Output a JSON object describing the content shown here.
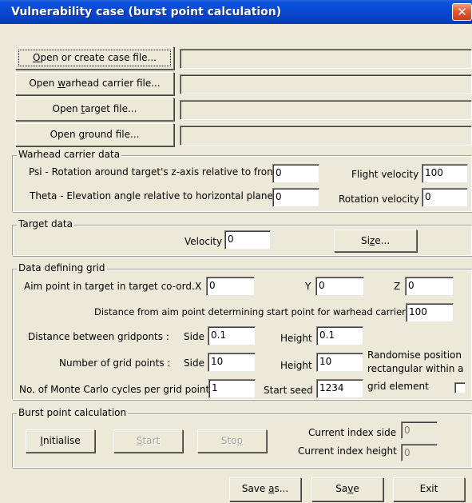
{
  "window": {
    "title": "Vulnerability case (burst point calculation)",
    "close_glyph": "✕"
  },
  "files": {
    "case_btn_pre": "",
    "case_btn_key": "O",
    "case_btn_post": "pen or create case file...",
    "warhead_btn_pre": "Open ",
    "warhead_btn_key": "w",
    "warhead_btn_post": "arhead carrier file...",
    "target_btn_pre": "Open ",
    "target_btn_key": "t",
    "target_btn_post": "arget file...",
    "ground_btn_pre": "Open ",
    "ground_btn_key": "g",
    "ground_btn_post": "round file...",
    "case_path": "",
    "warhead_path": "",
    "target_path": "",
    "ground_path": ""
  },
  "warhead": {
    "legend": "Warhead carrier data",
    "psi_label": "Psi - Rotation around target's z-axis relative to front",
    "psi_value": "0",
    "theta_label": "Theta - Elevation angle relative to horizontal plane",
    "theta_value": "0",
    "flight_velocity_label": "Flight velocity",
    "flight_velocity_value": "100",
    "rotation_velocity_label": "Rotation velocity",
    "rotation_velocity_value": "0"
  },
  "target": {
    "legend": "Target data",
    "velocity_label": "Velocity",
    "velocity_value": "0",
    "size_btn_pre": "Si",
    "size_btn_key": "z",
    "size_btn_post": "e..."
  },
  "grid": {
    "legend": "Data defining grid",
    "aim_label": "Aim point in target in target co-ord.",
    "x_label": "X",
    "x_value": "0",
    "y_label": "Y",
    "y_value": "0",
    "z_label": "Z",
    "z_value": "0",
    "distance_start_label": "Distance from aim point determining start point for warhead carrier",
    "distance_start_value": "100",
    "between_label": "Distance between gridponts :",
    "between_side_label": "Side",
    "between_side_value": "0.1",
    "between_height_label": "Height",
    "between_height_value": "0.1",
    "number_label": "Number of grid points :",
    "number_side_label": "Side",
    "number_side_value": "10",
    "number_height_label": "Height",
    "number_height_value": "10",
    "randomise_label_1": "Randomise position",
    "randomise_label_2": "rectangular within a",
    "randomise_label_3": "grid element",
    "randomise_checked": false,
    "montecarlo_label": "No. of Monte Carlo cycles per grid point",
    "montecarlo_value": "1",
    "seed_label": "Start seed",
    "seed_value": "1234"
  },
  "burst": {
    "legend": "Burst point calculation",
    "init_key": "I",
    "init_post": "nitialise",
    "start_pre": "",
    "start_key": "S",
    "start_post": "tart",
    "stop_pre": "Sto",
    "stop_key": "p",
    "stop_post": "",
    "index_side_label": "Current index side",
    "index_side_value": "0",
    "index_height_label": "Current index height",
    "index_height_value": "0"
  },
  "footer": {
    "saveas_pre": "Save ",
    "saveas_key": "a",
    "saveas_post": "s...",
    "save_pre": "Sa",
    "save_key": "v",
    "save_post": "e",
    "exit_label": "Exit"
  }
}
